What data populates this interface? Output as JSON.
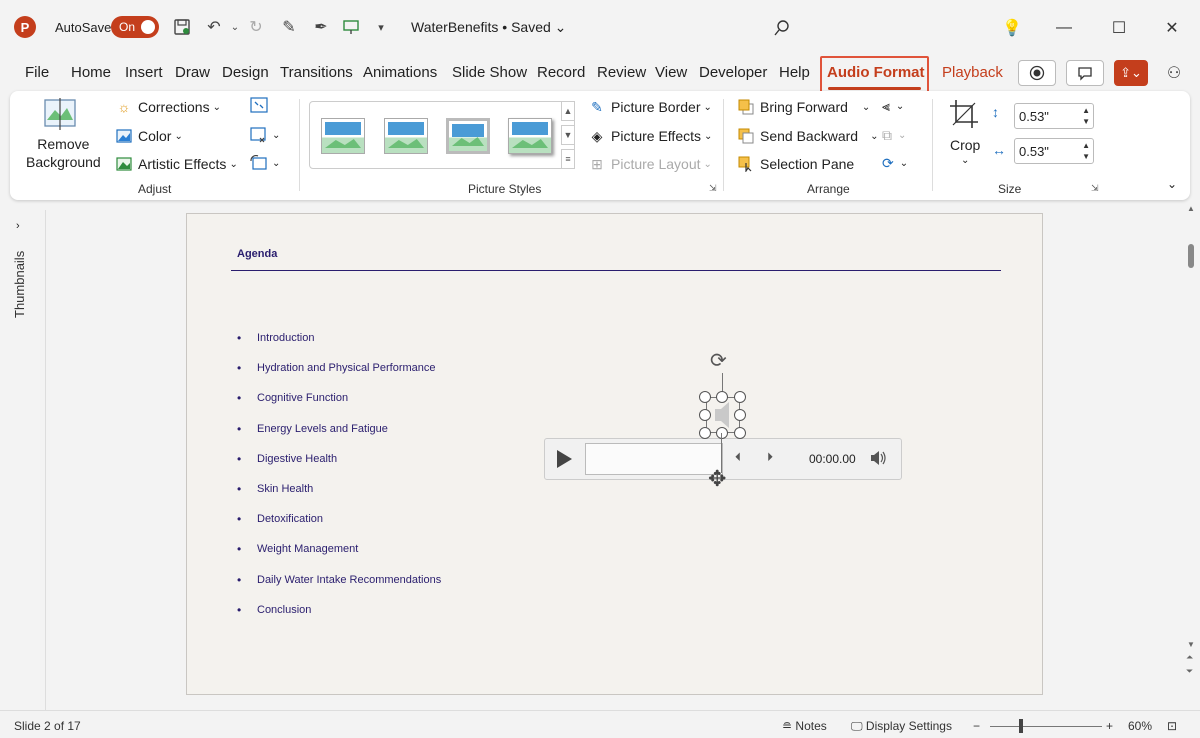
{
  "titlebar": {
    "app_icon": "P",
    "autosave_label": "AutoSave",
    "autosave_state": "On",
    "doc_title": "WaterBenefits • Saved"
  },
  "menu": {
    "tabs": [
      "File",
      "Home",
      "Insert",
      "Draw",
      "Design",
      "Transitions",
      "Animations",
      "Slide Show",
      "Record",
      "Review",
      "View",
      "Developer",
      "Help"
    ],
    "active_tab": "Audio Format",
    "playback_tab": "Playback"
  },
  "ribbon": {
    "adjust": {
      "remove_bg_line1": "Remove",
      "remove_bg_line2": "Background",
      "corrections": "Corrections",
      "color": "Color",
      "artistic_effects": "Artistic Effects",
      "group": "Adjust"
    },
    "picture_styles": {
      "border": "Picture Border",
      "effects": "Picture Effects",
      "layout": "Picture Layout",
      "group": "Picture Styles"
    },
    "arrange": {
      "bring_forward": "Bring Forward",
      "send_backward": "Send Backward",
      "selection_pane": "Selection Pane",
      "group": "Arrange"
    },
    "size": {
      "crop": "Crop",
      "height": "0.53\"",
      "width": "0.53\"",
      "group": "Size"
    }
  },
  "sidebar": {
    "thumbnails_label": "Thumbnails"
  },
  "slide": {
    "title": "Agenda",
    "items": [
      "Introduction",
      "Hydration and Physical Performance",
      "Cognitive Function",
      "Energy Levels and Fatigue",
      "Digestive Health",
      "Skin Health",
      "Detoxification",
      "Weight Management",
      "Daily Water Intake Recommendations",
      "Conclusion"
    ]
  },
  "player": {
    "time": "00:00.00"
  },
  "status": {
    "slide_info": "Slide 2 of 17",
    "notes": "Notes",
    "display_settings": "Display Settings",
    "zoom_minus": "−",
    "zoom_plus": "+",
    "zoom": "60%"
  },
  "colors": {
    "accent": "#c43e1c",
    "slide_text": "#2a1e6e",
    "highlight": "#e0533a"
  }
}
